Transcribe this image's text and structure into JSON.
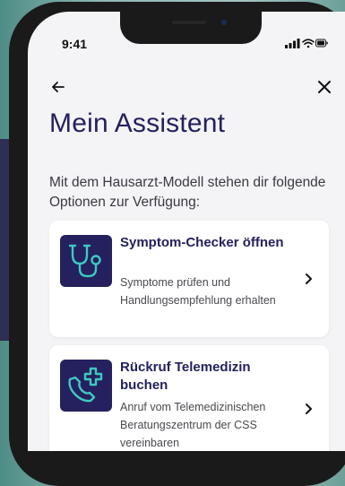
{
  "status_bar": {
    "time": "9:41"
  },
  "header": {
    "title": "Mein Assistent"
  },
  "intro_text": "Mit dem Hausarzt-Modell stehen dir folgende Optionen zur Verfügung:",
  "options": [
    {
      "title": "Symptom-Checker öffnen",
      "description": "Symptome prüfen und Handlungsempfehlung erhalten",
      "icon": "stethoscope-icon"
    },
    {
      "title": "Rückruf Telemedizin buchen",
      "description": "Anruf vom Telemedizinischen Beratungszentrum der CSS vereinbaren",
      "icon": "phone-plus-icon"
    }
  ],
  "colors": {
    "brand_navy": "#24215e",
    "accent_teal": "#3ec9c0",
    "screen_background": "#f4f3f5",
    "card_background": "#ffffff"
  }
}
